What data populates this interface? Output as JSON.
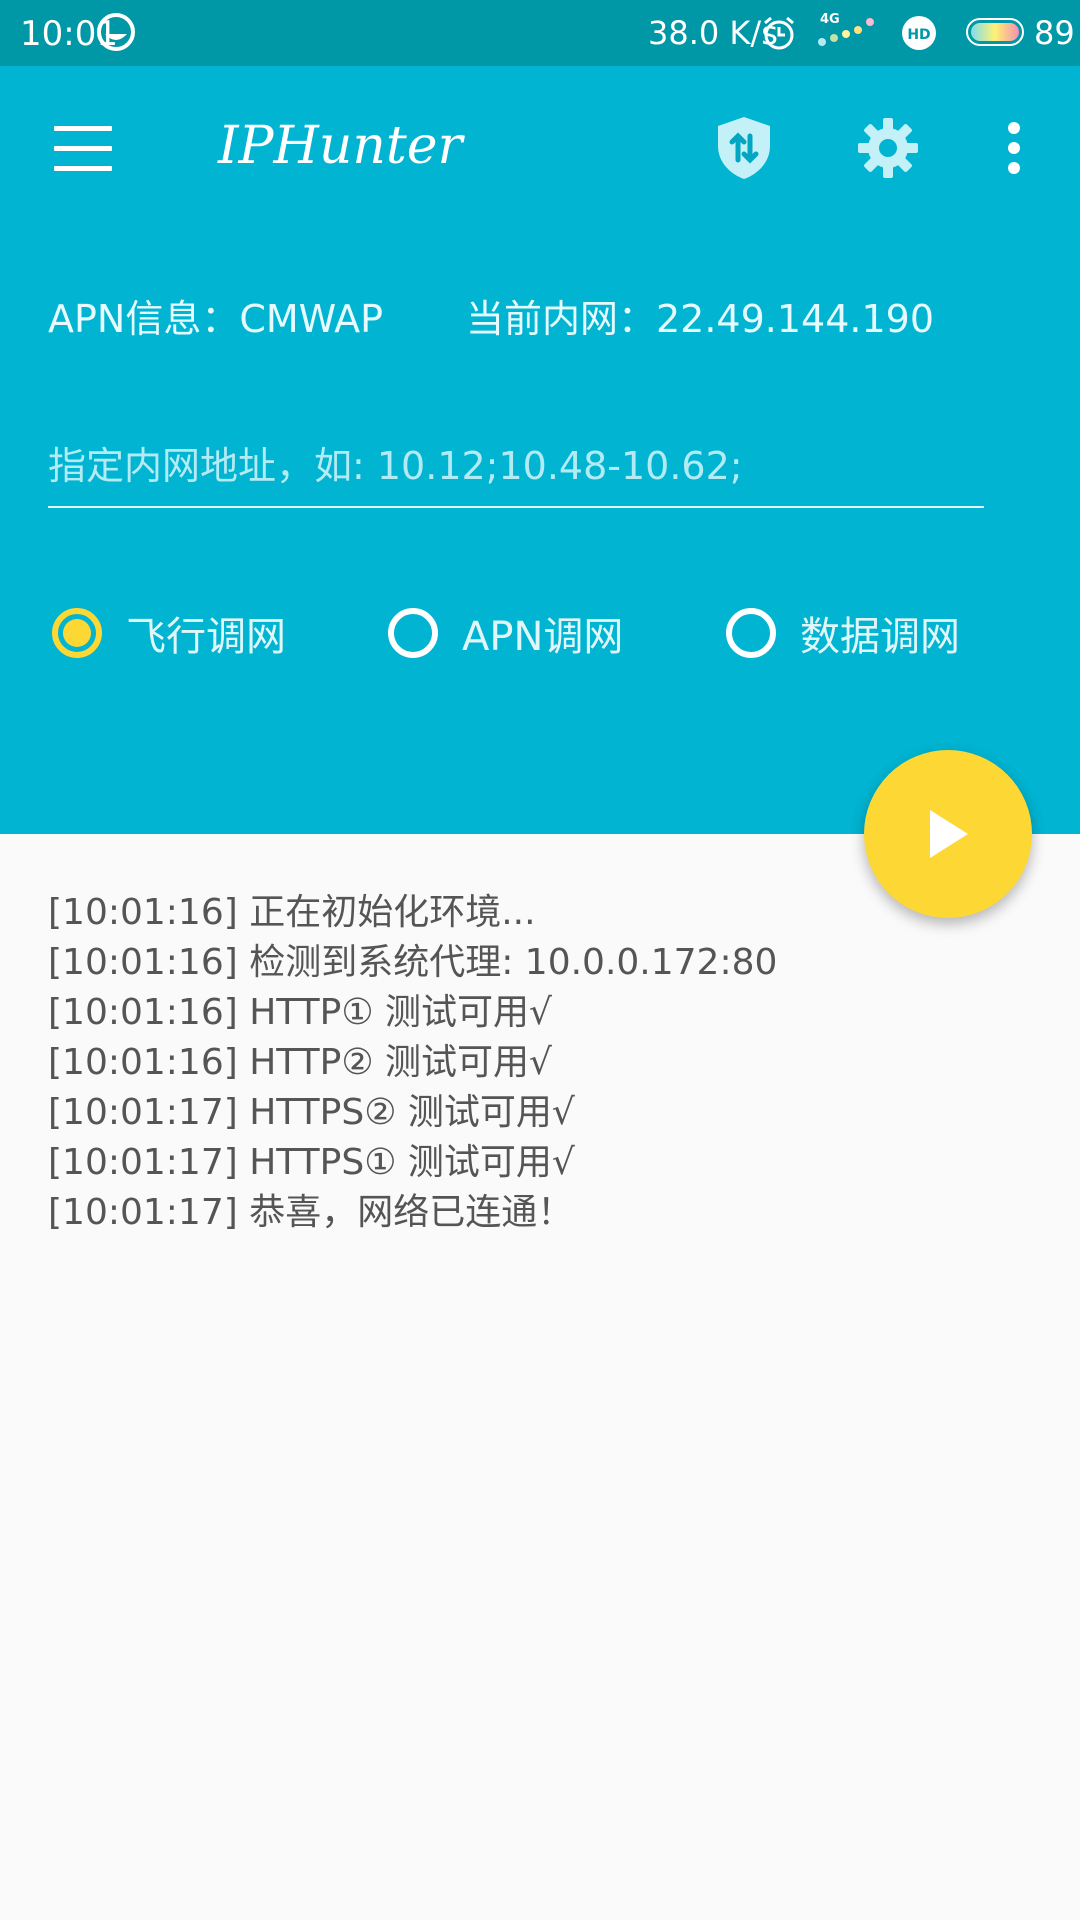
{
  "status_bar": {
    "time": "10:01",
    "speed": "38.0 K/s",
    "network": "4G",
    "battery": "89"
  },
  "toolbar": {
    "title": "IPHunter"
  },
  "info": {
    "apn_label": "APN信息：CMWAP",
    "intranet_label": "当前内网：22.49.144.190"
  },
  "address_input": {
    "placeholder": "指定内网地址，如: 10.12;10.48-10.62;",
    "value": ""
  },
  "modes": [
    {
      "label": "飞行调网",
      "checked": true
    },
    {
      "label": "APN调网",
      "checked": false
    },
    {
      "label": "数据调网",
      "checked": false
    }
  ],
  "log": [
    "[10:01:16] 正在初始化环境...",
    "[10:01:16] 检测到系统代理:   10.0.0.172:80",
    "[10:01:16] HTTP①   测试可用√",
    "[10:01:16] HTTP②   测试可用√",
    "[10:01:17] HTTPS② 测试可用√",
    "[10:01:17] HTTPS① 测试可用√",
    "[10:01:17] 恭喜，网络已连通！"
  ],
  "colors": {
    "primary": "#00b4d2",
    "status_bar": "#0097a7",
    "accent": "#fdd835"
  },
  "icons": [
    "menu-icon",
    "shield-icon",
    "gear-icon",
    "more-vert-icon",
    "play-icon"
  ]
}
